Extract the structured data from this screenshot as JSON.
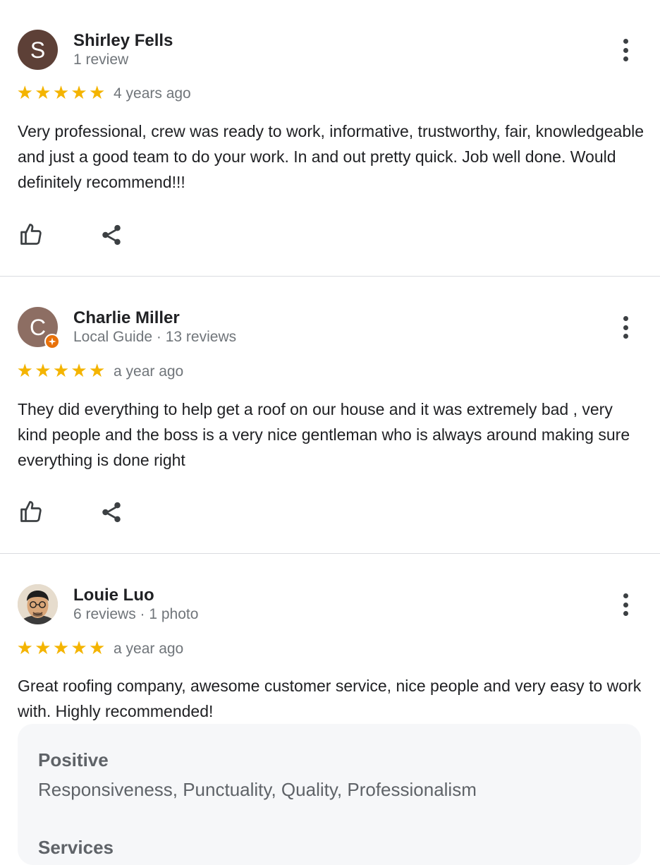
{
  "reviews": [
    {
      "avatar_letter": "S",
      "avatar_color": "#5d4037",
      "name": "Shirley Fells",
      "meta": "1 review",
      "rating": 5,
      "time": "4 years ago",
      "text": "Very professional, crew was ready to work, informative, trustworthy, fair, knowledgeable and just a good team to do your work. In and out pretty quick. Job well done. Would definitely recommend!!!"
    },
    {
      "avatar_letter": "C",
      "avatar_color": "#8d6e63",
      "local_guide_badge": "orange-star-badge",
      "name": "Charlie Miller",
      "meta": "Local Guide · 13 reviews",
      "rating": 5,
      "time": "a year ago",
      "text": "They did everything to help get a roof on our house and it was extremely bad , very kind people and the boss is a very nice gentleman who is always around making sure everything is done right"
    },
    {
      "avatar_photo": "man-with-glasses-photo",
      "name": "Louie Luo",
      "meta": "6 reviews · 1 photo",
      "rating": 5,
      "time": "a year ago",
      "text": "Great roofing company, awesome customer service, nice people and very easy to work with. Highly recommended!",
      "attributes": [
        {
          "label": "Positive",
          "value": "Responsiveness, Punctuality, Quality, Professionalism"
        },
        {
          "label": "Services",
          "value": ""
        }
      ]
    }
  ],
  "star_glyph": "★",
  "icons": {
    "like": "thumbs-up-icon",
    "share": "share-icon",
    "more": "more-vert-icon"
  },
  "colors": {
    "star": "#f4b400",
    "divider": "#dadce0",
    "badge": "#e8710a"
  }
}
